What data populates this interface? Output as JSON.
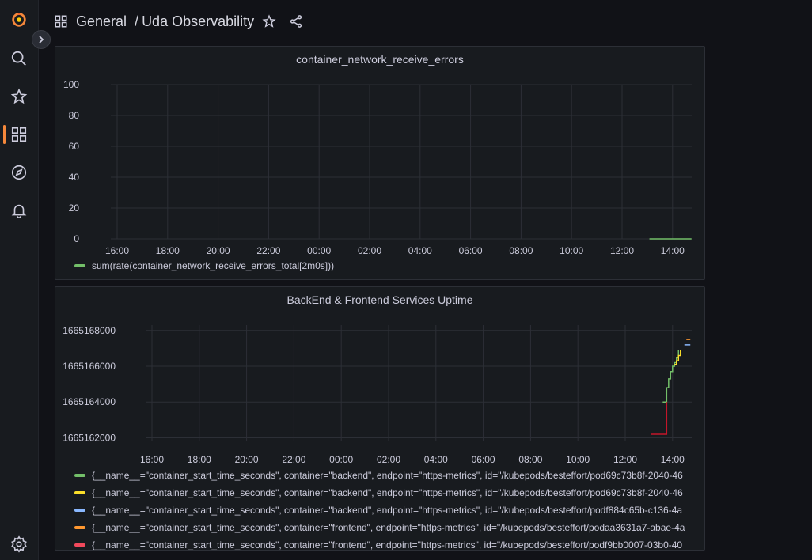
{
  "breadcrumb": {
    "folder": "General",
    "separator": "/",
    "dashboard": "Uda Observability"
  },
  "sidebar": {
    "items": [
      {
        "name": "search-icon"
      },
      {
        "name": "star-icon"
      },
      {
        "name": "dashboards-icon",
        "active": true
      },
      {
        "name": "explore-icon"
      },
      {
        "name": "alerting-icon"
      },
      {
        "name": "settings-icon"
      }
    ]
  },
  "colors": {
    "accent": "#f5883b",
    "green": "#73bf69",
    "yellow": "#fade2a",
    "blue": "#8ab8ff",
    "orange": "#ff9830",
    "red": "#c4162a"
  },
  "panels": [
    {
      "title": "container_network_receive_errors",
      "legend": [
        {
          "color": "#73bf69",
          "label": "sum(rate(container_network_receive_errors_total[2m0s]))"
        }
      ]
    },
    {
      "title": "BackEnd & Frontend Services Uptime",
      "legend": [
        {
          "color": "#73bf69",
          "label": "{__name__=\"container_start_time_seconds\", container=\"backend\", endpoint=\"https-metrics\", id=\"/kubepods/besteffort/pod69c73b8f-2040-46"
        },
        {
          "color": "#fade2a",
          "label": "{__name__=\"container_start_time_seconds\", container=\"backend\", endpoint=\"https-metrics\", id=\"/kubepods/besteffort/pod69c73b8f-2040-46"
        },
        {
          "color": "#8ab8ff",
          "label": "{__name__=\"container_start_time_seconds\", container=\"backend\", endpoint=\"https-metrics\", id=\"/kubepods/besteffort/podf884c65b-c136-4a"
        },
        {
          "color": "#ff9830",
          "label": "{__name__=\"container_start_time_seconds\", container=\"frontend\", endpoint=\"https-metrics\", id=\"/kubepods/besteffort/podaa3631a7-abae-4a"
        },
        {
          "color": "#f2495c",
          "label": "{__name__=\"container_start_time_seconds\", container=\"frontend\", endpoint=\"https-metrics\", id=\"/kubepods/besteffort/podf9bb0007-03b0-40"
        }
      ]
    }
  ],
  "chart_data": [
    {
      "type": "line",
      "title": "container_network_receive_errors",
      "x": [
        "16:00",
        "18:00",
        "20:00",
        "22:00",
        "00:00",
        "02:00",
        "04:00",
        "06:00",
        "08:00",
        "10:00",
        "12:00",
        "14:00"
      ],
      "yticks": [
        0,
        20,
        40,
        60,
        80,
        100
      ],
      "ylim": [
        0,
        100
      ],
      "grid": true,
      "series": [
        {
          "name": "sum(rate(container_network_receive_errors_total[2m0s]))",
          "color": "#73bf69",
          "points": [
            [
              "13:05",
              0
            ],
            [
              "14:00",
              0
            ],
            [
              "14:45",
              0
            ]
          ]
        }
      ]
    },
    {
      "type": "line",
      "title": "BackEnd & Frontend Services Uptime",
      "x": [
        "16:00",
        "18:00",
        "20:00",
        "22:00",
        "00:00",
        "02:00",
        "04:00",
        "06:00",
        "08:00",
        "10:00",
        "12:00",
        "14:00"
      ],
      "yticks": [
        1665162000,
        1665164000,
        1665166000,
        1665168000
      ],
      "ylim": [
        1665161800,
        1665168300
      ],
      "grid": true,
      "series": [
        {
          "color": "#73bf69",
          "points": [
            [
              "13:35",
              1665164000
            ],
            [
              "13:45",
              1665164800
            ],
            [
              "13:50",
              1665165300
            ],
            [
              "13:55",
              1665165700
            ],
            [
              "14:00",
              1665166000
            ],
            [
              "14:05",
              1665166200
            ],
            [
              "14:10",
              1665166500
            ],
            [
              "14:15",
              1665166900
            ]
          ]
        },
        {
          "color": "#fade2a",
          "points": [
            [
              "14:05",
              1665166100
            ],
            [
              "14:10",
              1665166300
            ],
            [
              "14:15",
              1665166600
            ],
            [
              "14:20",
              1665166900
            ]
          ]
        },
        {
          "color": "#8ab8ff",
          "points": [
            [
              "14:30",
              1665167200
            ],
            [
              "14:45",
              1665167200
            ]
          ]
        },
        {
          "color": "#ff9830",
          "points": [
            [
              "14:35",
              1665167500
            ],
            [
              "14:45",
              1665167500
            ]
          ]
        },
        {
          "color": "#c4162a",
          "points": [
            [
              "13:05",
              1665162200
            ],
            [
              "13:45",
              1665162200
            ],
            [
              "13:45",
              1665164000
            ]
          ]
        }
      ]
    }
  ]
}
